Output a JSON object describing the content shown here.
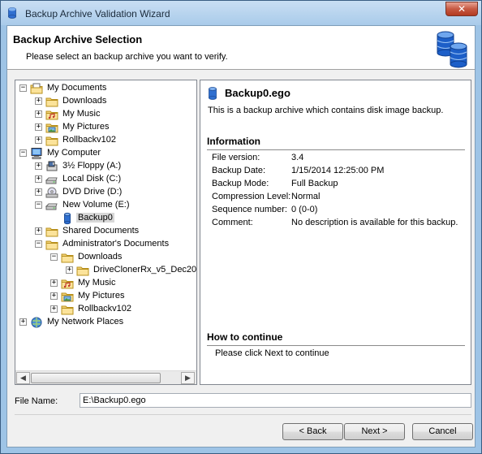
{
  "window": {
    "title": "Backup Archive Validation Wizard",
    "close_glyph": "✕"
  },
  "header": {
    "title": "Backup Archive Selection",
    "subtitle": "Please select an backup archive you want to verify.",
    "icon": "database-icon"
  },
  "tree": {
    "items": [
      {
        "label": "My Documents",
        "level": 0,
        "expander": "−",
        "icon": "documents-icon"
      },
      {
        "label": "Downloads",
        "level": 1,
        "expander": "+",
        "icon": "folder-icon"
      },
      {
        "label": "My Music",
        "level": 1,
        "expander": "+",
        "icon": "music-folder-icon"
      },
      {
        "label": "My Pictures",
        "level": 1,
        "expander": "+",
        "icon": "pictures-folder-icon"
      },
      {
        "label": "Rollbackv102",
        "level": 1,
        "expander": "+",
        "icon": "folder-icon"
      },
      {
        "label": "My Computer",
        "level": 0,
        "expander": "−",
        "icon": "computer-icon"
      },
      {
        "label": "3½ Floppy (A:)",
        "level": 1,
        "expander": "+",
        "icon": "floppy-icon"
      },
      {
        "label": "Local Disk (C:)",
        "level": 1,
        "expander": "+",
        "icon": "hard-disk-icon"
      },
      {
        "label": "DVD Drive (D:)",
        "level": 1,
        "expander": "+",
        "icon": "dvd-drive-icon"
      },
      {
        "label": "New Volume (E:)",
        "level": 1,
        "expander": "−",
        "icon": "hard-disk-icon"
      },
      {
        "label": "Backup0",
        "level": 2,
        "expander": "",
        "icon": "database-icon",
        "selected": true
      },
      {
        "label": "Shared Documents",
        "level": 1,
        "expander": "+",
        "icon": "folder-icon"
      },
      {
        "label": "Administrator's Documents",
        "level": 1,
        "expander": "−",
        "icon": "folder-icon"
      },
      {
        "label": "Downloads",
        "level": 2,
        "expander": "−",
        "icon": "folder-icon"
      },
      {
        "label": "DriveClonerRx_v5_Dec20",
        "level": 3,
        "expander": "+",
        "icon": "folder-icon"
      },
      {
        "label": "My Music",
        "level": 2,
        "expander": "+",
        "icon": "music-folder-icon"
      },
      {
        "label": "My Pictures",
        "level": 2,
        "expander": "+",
        "icon": "pictures-folder-icon"
      },
      {
        "label": "Rollbackv102",
        "level": 2,
        "expander": "+",
        "icon": "folder-icon"
      },
      {
        "label": "My Network Places",
        "level": 0,
        "expander": "+",
        "icon": "network-icon"
      }
    ],
    "scroll_left_glyph": "◀",
    "scroll_right_glyph": "▶"
  },
  "details": {
    "archive_name": "Backup0.ego",
    "description": "This is a backup archive which contains disk image backup.",
    "information_title": "Information",
    "properties": [
      {
        "key": "File version:",
        "value": "3.4"
      },
      {
        "key": "Backup Date:",
        "value": "1/15/2014 12:25:00 PM"
      },
      {
        "key": "Backup Mode:",
        "value": "Full Backup"
      },
      {
        "key": "Compression Level:",
        "value": "Normal"
      },
      {
        "key": "Sequence number:",
        "value": "0 (0-0)"
      },
      {
        "key": "Comment:",
        "value": "No description is available for this backup."
      }
    ],
    "continue_title": "How to continue",
    "continue_text": "Please click Next to continue"
  },
  "file_name": {
    "label": "File Name:",
    "value": "E:\\Backup0.ego"
  },
  "buttons": {
    "back": "< Back",
    "next": "Next >",
    "cancel": "Cancel"
  }
}
